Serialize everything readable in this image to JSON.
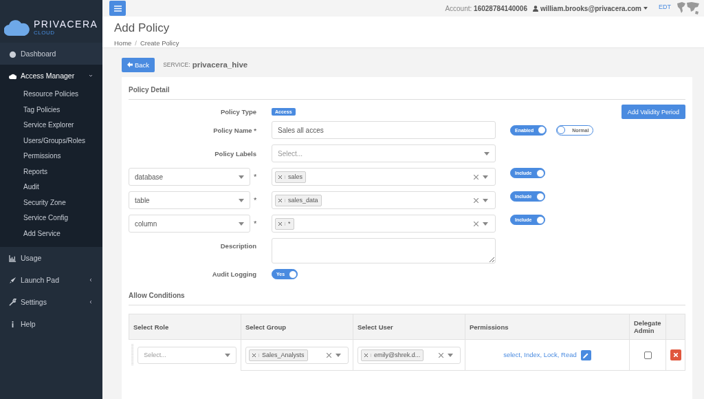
{
  "sidebar": {
    "logo": {
      "name": "PRIVACERA",
      "sub": "CLOUD"
    },
    "items": [
      {
        "label": "Dashboard",
        "kind": "link"
      },
      {
        "label": "Access Manager",
        "kind": "group",
        "expanded": true,
        "children": [
          {
            "label": "Resource Policies"
          },
          {
            "label": "Tag Policies"
          },
          {
            "label": "Service Explorer"
          },
          {
            "label": "Users/Groups/Roles"
          },
          {
            "label": "Permissions"
          },
          {
            "label": "Reports"
          },
          {
            "label": "Audit"
          },
          {
            "label": "Security Zone"
          },
          {
            "label": "Service Config"
          },
          {
            "label": "Add Service"
          }
        ]
      },
      {
        "label": "Usage",
        "kind": "link"
      },
      {
        "label": "Launch Pad",
        "kind": "group",
        "expanded": false
      },
      {
        "label": "Settings",
        "kind": "group",
        "expanded": false
      },
      {
        "label": "Help",
        "kind": "link"
      }
    ]
  },
  "topbar": {
    "account": "Account: **16028784140006**",
    "user": "william.brooks@privacera.com",
    "timezone": "EDT"
  },
  "header": {
    "title": "Add Policy",
    "breadcrumbs": [
      "Home",
      "Create Policy"
    ],
    "separator": "/"
  },
  "service": {
    "back": "Back",
    "label": "SERVICE:",
    "name": "privacera_hive"
  },
  "panel": {
    "title": "Policy Detail",
    "validity_button": "Add Validity Period",
    "policy_type": {
      "label": "Policy Type",
      "value": "Access"
    },
    "policy_name": {
      "label": "Policy Name *",
      "value": "Sales all acces",
      "toggles": [
        {
          "label": "Enabled",
          "on": true
        },
        {
          "label": "Normal",
          "on": false
        }
      ]
    },
    "policy_labels": {
      "label": "Policy Labels",
      "placeholder": "Select..."
    },
    "required_mark": "*",
    "resources": [
      {
        "type": "database",
        "values": [
          "sales"
        ],
        "toggle": {
          "label": "Include",
          "on": true
        }
      },
      {
        "type": "table",
        "values": [
          "sales_data"
        ],
        "toggle": {
          "label": "Include",
          "on": true
        }
      },
      {
        "type": "column",
        "values": [
          "*"
        ],
        "toggle": {
          "label": "Include",
          "on": true
        }
      }
    ],
    "description": {
      "label": "Description"
    },
    "audit": {
      "label": "Audit Logging",
      "toggle": {
        "label": "Yes",
        "on": true
      }
    },
    "allow": {
      "title": "Allow Conditions",
      "columns": [
        "Select Role",
        "Select Group",
        "Select User",
        "Permissions",
        "Delegate Admin"
      ],
      "rows": [
        {
          "role_placeholder": "Select...",
          "groups": [
            "Sales_Analysts"
          ],
          "users": [
            "emily@shrek.d..."
          ],
          "permissions": "select, Index, Lock, Read",
          "delegate_admin": false
        }
      ]
    }
  }
}
